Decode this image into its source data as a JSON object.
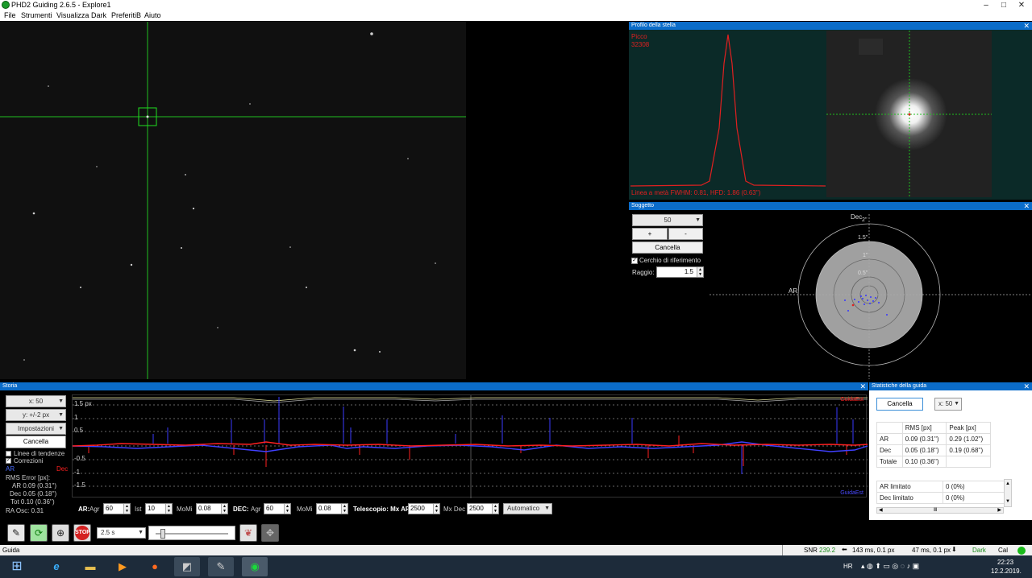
{
  "window": {
    "title": "PHD2 Guiding 2.6.5 - Explore1",
    "min": "–",
    "max": "□",
    "close": "✕"
  },
  "menu": [
    "File",
    "Strumenti",
    "Visualizza",
    "Dark",
    "PreferitiB",
    "Aiuto"
  ],
  "profile": {
    "title": "Profilo della stella",
    "peak_label": "Picco",
    "peak_value": "32308",
    "fwhm": "Linea a metà FWHM: 0.81, HFD: 1.86 (0.63'')"
  },
  "target": {
    "title": "Soggetto",
    "zoom": "50",
    "plus": "+",
    "minus": "-",
    "clear": "Cancella",
    "ref_circle": "Cerchio di riferimento",
    "radius_label": "Raggio:",
    "radius_value": "1.5",
    "ar_label": "AR",
    "dec_label": "Dec",
    "ticks": [
      "2''",
      "1.5''",
      "1''",
      "0.5''"
    ]
  },
  "history": {
    "title": "Storia",
    "x_combo": "x: 50",
    "y_combo": "y: +/-2 px",
    "settings": "Impostazioni",
    "clear": "Cancella",
    "trend": "Linee di tendenze",
    "corrections": "Correzioni",
    "ar": "AR",
    "dec": "Dec",
    "rms_title": "RMS Error [px]:",
    "rms_ar": "AR 0.09 (0.31'')",
    "rms_dec": "Dec 0.05 (0.18'')",
    "rms_tot": "Tot 0.10 (0.36'')",
    "ra_osc": "RA Osc: 0.31",
    "y_ticks": [
      "1.5 px",
      "1",
      "0.5",
      "",
      "-0.5",
      "-1",
      "-1.5"
    ],
    "top_label": "GuidaEst",
    "bottom_label": "GuidaEst"
  },
  "controls": {
    "ar": "AR:",
    "agr": "Agr",
    "agr_val": "60",
    "ist": "Ist",
    "ist_val": "10",
    "momi": "MoMi",
    "momi_val": "0.08",
    "dec": "DEC:",
    "dec_agr": "Agr",
    "dec_agr_val": "60",
    "dec_momi": "MoMi",
    "dec_momi_val": "0.08",
    "scope": "Telescopio: Mx AR",
    "mx_ar_val": "2500",
    "mx_dec": "Mx Dec",
    "mx_dec_val": "2500",
    "mode": "Automatico"
  },
  "stats": {
    "title": "Statistiche della guida",
    "clear": "Cancella",
    "x_combo": "x: 50",
    "headers": [
      "",
      "RMS [px]",
      "Peak [px]"
    ],
    "rows": [
      [
        "AR",
        "0.09 (0.31'')",
        "0.29 (1.02'')"
      ],
      [
        "Dec",
        "0.05 (0.18'')",
        "0.19 (0.68'')"
      ],
      [
        "Totale",
        "0.10 (0.36'')",
        ""
      ]
    ],
    "limits": [
      [
        "AR limitato",
        "0 (0%)"
      ],
      [
        "Dec limitato",
        "0 (0%)"
      ]
    ],
    "scroll_glyph": "Ⅲ"
  },
  "toolbar": {
    "exposure": "2.5 s",
    "stop": "STOP"
  },
  "status": {
    "left": "Guida",
    "snr_label": "SNR",
    "snr_value": "239.2",
    "ra_pulse": "143 ms, 0.1 px",
    "dec_pulse": "47 ms, 0.1 px",
    "dark": "Dark",
    "cal": "Cal"
  },
  "taskbar": {
    "lang": "HR",
    "time": "22:23",
    "date": "12.2.2019."
  },
  "colors": {
    "ra": "#4040ff",
    "dec": "#ff2020",
    "accent": "#0b6cc9"
  }
}
